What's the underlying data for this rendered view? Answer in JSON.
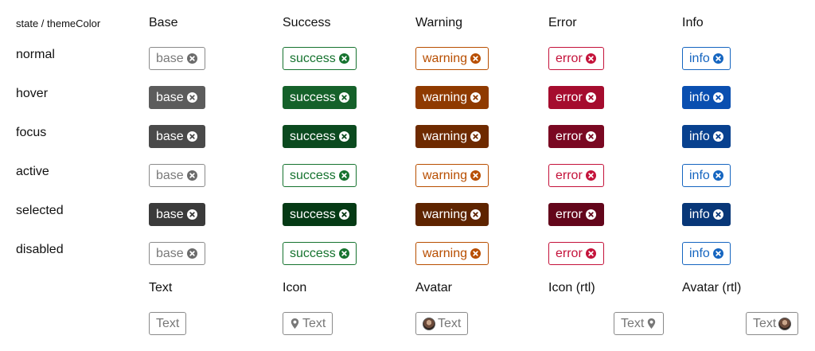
{
  "corner_label": "state / themeColor",
  "columns": [
    "Base",
    "Success",
    "Warning",
    "Error",
    "Info"
  ],
  "states": [
    "normal",
    "hover",
    "focus",
    "active",
    "selected",
    "disabled"
  ],
  "chip_labels": [
    "base",
    "success",
    "warning",
    "error",
    "info"
  ],
  "colors": {
    "base": {
      "normal": "#6b6b6b",
      "hover": "#5c5c5c",
      "focus": "#4a4a4a",
      "selected": "#3b3b3b"
    },
    "success": {
      "normal": "#16732f",
      "hover": "#15612a",
      "focus": "#0b4a1f",
      "selected": "#053a15"
    },
    "warning": {
      "normal": "#b84e00",
      "hover": "#8f3a00",
      "focus": "#6e2a00",
      "selected": "#5e2400"
    },
    "error": {
      "normal": "#c4123a",
      "hover": "#a50c2e",
      "focus": "#7a0822",
      "selected": "#63061b"
    },
    "info": {
      "normal": "#1565c0",
      "hover": "#0a4fb0",
      "focus": "#08418f",
      "selected": "#083778"
    }
  },
  "demo_headers": [
    "Text",
    "Icon",
    "Avatar",
    "Icon (rtl)",
    "Avatar (rtl)"
  ],
  "demo_text": "Text"
}
